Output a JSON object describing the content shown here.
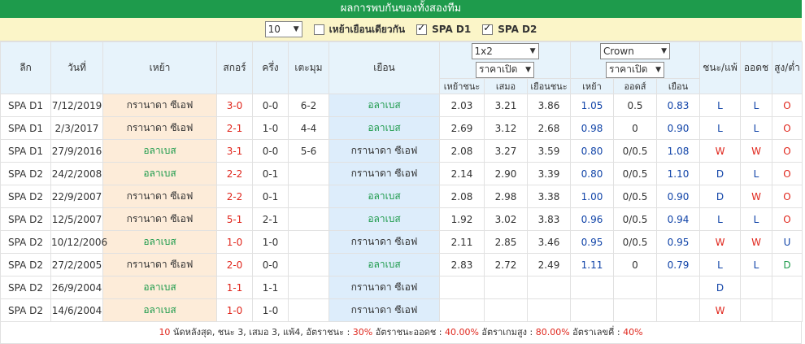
{
  "title": "ผลการพบกันของทั้งสองทีม",
  "filter": {
    "count_value": "10",
    "home_only_label": "เหย้าเยือนเดียวกัน",
    "home_only_checked": false,
    "league1_label": "SPA D1",
    "league1_checked": true,
    "league2_label": "SPA D2",
    "league2_checked": true
  },
  "headers": {
    "league": "ลีก",
    "date": "วันที่",
    "home": "เหย้า",
    "score": "สกอร์",
    "half": "ครึ่ง",
    "corner": "เตะมุม",
    "away": "เยือน",
    "odds1_type": "1x2",
    "odds1_mode": "ราคาเปิด",
    "odds2_company": "Crown",
    "odds2_mode": "ราคาเปิด",
    "win_lose": "ชนะ/แพ้",
    "handicap": "ออดช",
    "over_under": "สูง/ต่ำ",
    "sub": [
      "เหย้าชนะ",
      "เสมอ",
      "เยือนชนะ",
      "เหย้า",
      "ออดส์",
      "เยือน"
    ]
  },
  "rows": [
    {
      "league": "SPA D1",
      "date": "7/12/2019",
      "home": "กรานาดา ซีเอฟ",
      "home_green": false,
      "score": "3-0",
      "half": "0-0",
      "corner": "6-2",
      "away": "อลาเบส",
      "away_green": true,
      "h": "2.03",
      "d": "3.21",
      "a": "3.86",
      "ch": "1.05",
      "co": "0.5",
      "ca": "0.83",
      "wl": "L",
      "hc": "L",
      "ou": "O"
    },
    {
      "league": "SPA D1",
      "date": "2/3/2017",
      "home": "กรานาดา ซีเอฟ",
      "home_green": false,
      "score": "2-1",
      "half": "1-0",
      "corner": "4-4",
      "away": "อลาเบส",
      "away_green": true,
      "h": "2.69",
      "d": "3.12",
      "a": "2.68",
      "ch": "0.98",
      "co": "0",
      "ca": "0.90",
      "wl": "L",
      "hc": "L",
      "ou": "O"
    },
    {
      "league": "SPA D1",
      "date": "27/9/2016",
      "home": "อลาเบส",
      "home_green": true,
      "score": "3-1",
      "half": "0-0",
      "corner": "5-6",
      "away": "กรานาดา ซีเอฟ",
      "away_green": false,
      "h": "2.08",
      "d": "3.27",
      "a": "3.59",
      "ch": "0.80",
      "co": "0/0.5",
      "ca": "1.08",
      "wl": "W",
      "hc": "W",
      "ou": "O"
    },
    {
      "league": "SPA D2",
      "date": "24/2/2008",
      "home": "อลาเบส",
      "home_green": true,
      "score": "2-2",
      "half": "0-1",
      "corner": "",
      "away": "กรานาดา ซีเอฟ",
      "away_green": false,
      "h": "2.14",
      "d": "2.90",
      "a": "3.39",
      "ch": "0.80",
      "co": "0/0.5",
      "ca": "1.10",
      "wl": "D",
      "hc": "L",
      "ou": "O"
    },
    {
      "league": "SPA D2",
      "date": "22/9/2007",
      "home": "กรานาดา ซีเอฟ",
      "home_green": false,
      "score": "2-2",
      "half": "0-1",
      "corner": "",
      "away": "อลาเบส",
      "away_green": true,
      "h": "2.08",
      "d": "2.98",
      "a": "3.38",
      "ch": "1.00",
      "co": "0/0.5",
      "ca": "0.90",
      "wl": "D",
      "hc": "W",
      "ou": "O"
    },
    {
      "league": "SPA D2",
      "date": "12/5/2007",
      "home": "กรานาดา ซีเอฟ",
      "home_green": false,
      "score": "5-1",
      "half": "2-1",
      "corner": "",
      "away": "อลาเบส",
      "away_green": true,
      "h": "1.92",
      "d": "3.02",
      "a": "3.83",
      "ch": "0.96",
      "co": "0/0.5",
      "ca": "0.94",
      "wl": "L",
      "hc": "L",
      "ou": "O"
    },
    {
      "league": "SPA D2",
      "date": "10/12/2006",
      "home": "อลาเบส",
      "home_green": true,
      "score": "1-0",
      "half": "1-0",
      "corner": "",
      "away": "กรานาดา ซีเอฟ",
      "away_green": false,
      "h": "2.11",
      "d": "2.85",
      "a": "3.46",
      "ch": "0.95",
      "co": "0/0.5",
      "ca": "0.95",
      "wl": "W",
      "hc": "W",
      "ou": "U"
    },
    {
      "league": "SPA D2",
      "date": "27/2/2005",
      "home": "กรานาดา ซีเอฟ",
      "home_green": false,
      "score": "2-0",
      "half": "0-0",
      "corner": "",
      "away": "อลาเบส",
      "away_green": true,
      "h": "2.83",
      "d": "2.72",
      "a": "2.49",
      "ch": "1.11",
      "co": "0",
      "ca": "0.79",
      "wl": "L",
      "hc": "L",
      "ou": "D"
    },
    {
      "league": "SPA D2",
      "date": "26/9/2004",
      "home": "อลาเบส",
      "home_green": true,
      "score": "1-1",
      "half": "1-1",
      "corner": "",
      "away": "กรานาดา ซีเอฟ",
      "away_green": false,
      "h": "",
      "d": "",
      "a": "",
      "ch": "",
      "co": "",
      "ca": "",
      "wl": "D",
      "hc": "",
      "ou": ""
    },
    {
      "league": "SPA D2",
      "date": "14/6/2004",
      "home": "อลาเบส",
      "home_green": true,
      "score": "1-0",
      "half": "1-0",
      "corner": "",
      "away": "กรานาดา ซีเอฟ",
      "away_green": false,
      "h": "",
      "d": "",
      "a": "",
      "ch": "",
      "co": "",
      "ca": "",
      "wl": "W",
      "hc": "",
      "ou": ""
    }
  ],
  "footer": {
    "count": "10",
    "summary": " นัดหลังสุด, ชนะ 3, เสมอ 3, แพ้4, อัตราชนะ : ",
    "win_rate": "30%",
    "hc_label": " อัตราชนะออดช : ",
    "hc_rate": "40.00%",
    "over_label": " อัตราเกมสูง : ",
    "over_rate": "80.00%",
    "even_label": " อัตราเลขคี่ : ",
    "even_rate": "40%"
  },
  "colors": {
    "header_green": "#1e9b4c",
    "home_green": "#1e9b4c",
    "score_red": "#e0261c",
    "odds_blue": "#1144a8",
    "W": "#e0261c",
    "D": "#1144a8",
    "L": "#1144a8",
    "O": "#e0261c",
    "U": "#1144a8",
    "OD": "#1e9b4c"
  }
}
